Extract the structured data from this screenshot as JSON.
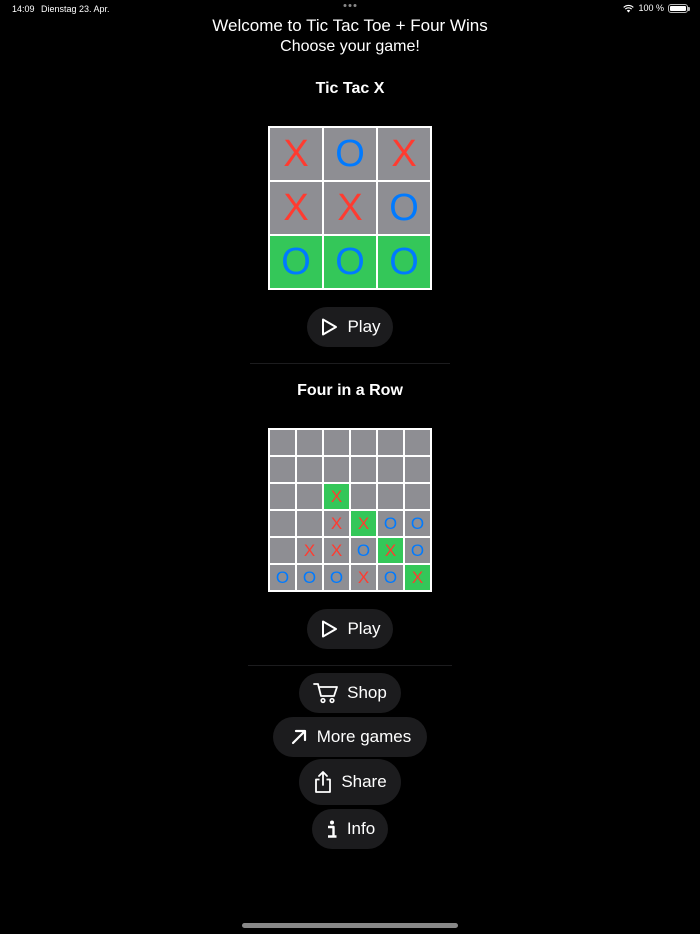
{
  "status_bar": {
    "time": "14:09",
    "date": "Dienstag 23. Apr.",
    "battery_text": "100 %",
    "battery_level": 1.0
  },
  "header": {
    "title": "Welcome to Tic Tac Toe + Four Wins",
    "subtitle": "Choose your game!"
  },
  "tic_tac_x": {
    "title": "Tic Tac X",
    "play_label": "Play",
    "board": [
      [
        {
          "mark": "X",
          "win": false
        },
        {
          "mark": "O",
          "win": false
        },
        {
          "mark": "X",
          "win": false
        }
      ],
      [
        {
          "mark": "X",
          "win": false
        },
        {
          "mark": "X",
          "win": false
        },
        {
          "mark": "O",
          "win": false
        }
      ],
      [
        {
          "mark": "O",
          "win": true
        },
        {
          "mark": "O",
          "win": true
        },
        {
          "mark": "O",
          "win": true
        }
      ]
    ]
  },
  "four_in_a_row": {
    "title": "Four in a Row",
    "play_label": "Play",
    "board": [
      [
        {
          "mark": "",
          "win": false
        },
        {
          "mark": "",
          "win": false
        },
        {
          "mark": "",
          "win": false
        },
        {
          "mark": "",
          "win": false
        },
        {
          "mark": "",
          "win": false
        },
        {
          "mark": "",
          "win": false
        }
      ],
      [
        {
          "mark": "",
          "win": false
        },
        {
          "mark": "",
          "win": false
        },
        {
          "mark": "",
          "win": false
        },
        {
          "mark": "",
          "win": false
        },
        {
          "mark": "",
          "win": false
        },
        {
          "mark": "",
          "win": false
        }
      ],
      [
        {
          "mark": "",
          "win": false
        },
        {
          "mark": "",
          "win": false
        },
        {
          "mark": "X",
          "win": true
        },
        {
          "mark": "",
          "win": false
        },
        {
          "mark": "",
          "win": false
        },
        {
          "mark": "",
          "win": false
        }
      ],
      [
        {
          "mark": "",
          "win": false
        },
        {
          "mark": "",
          "win": false
        },
        {
          "mark": "X",
          "win": false
        },
        {
          "mark": "X",
          "win": true
        },
        {
          "mark": "O",
          "win": false
        },
        {
          "mark": "O",
          "win": false
        }
      ],
      [
        {
          "mark": "",
          "win": false
        },
        {
          "mark": "X",
          "win": false
        },
        {
          "mark": "X",
          "win": false
        },
        {
          "mark": "O",
          "win": false
        },
        {
          "mark": "X",
          "win": true
        },
        {
          "mark": "O",
          "win": false
        }
      ],
      [
        {
          "mark": "O",
          "win": false
        },
        {
          "mark": "O",
          "win": false
        },
        {
          "mark": "O",
          "win": false
        },
        {
          "mark": "X",
          "win": false
        },
        {
          "mark": "O",
          "win": false
        },
        {
          "mark": "X",
          "win": true
        }
      ]
    ]
  },
  "menu": {
    "shop_label": "Shop",
    "more_games_label": "More games",
    "share_label": "Share",
    "info_label": "Info"
  },
  "icons": {
    "play": "play-icon",
    "shop": "cart-icon",
    "more_games": "arrow-up-right-icon",
    "share": "share-icon",
    "info": "info-icon"
  },
  "colors": {
    "background": "#000000",
    "cell": "#8e8e93",
    "win": "#34c759",
    "x_mark": "#ff3b30",
    "o_mark": "#007aff",
    "button_bg": "#1c1c1e"
  }
}
